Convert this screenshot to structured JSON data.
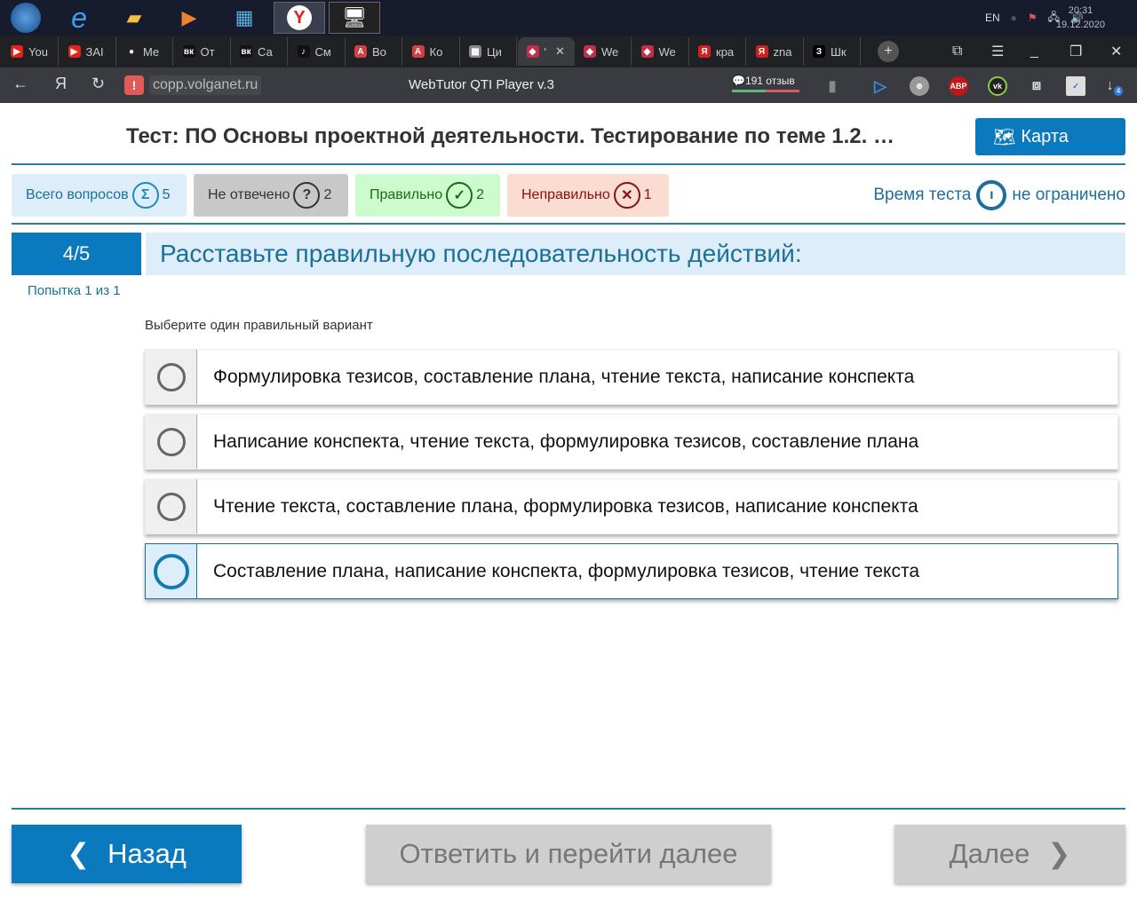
{
  "taskbar": {
    "lang": "EN",
    "time": "20:31",
    "date": "19.12.2020"
  },
  "tabs": [
    {
      "label": "You",
      "color": "#e62117",
      "glyph": "▶"
    },
    {
      "label": "ЗАІ",
      "color": "#e62117",
      "glyph": "▶"
    },
    {
      "label": "Me",
      "color": "#222",
      "glyph": "●"
    },
    {
      "label": "От",
      "color": "#111",
      "glyph": "вк"
    },
    {
      "label": "Са",
      "color": "#111",
      "glyph": "вк"
    },
    {
      "label": "См",
      "color": "#111",
      "glyph": "♪"
    },
    {
      "label": "Во",
      "color": "#d04040",
      "glyph": "A"
    },
    {
      "label": "Ко",
      "color": "#d04040",
      "glyph": "A"
    },
    {
      "label": "Ци",
      "color": "#888",
      "glyph": "▦"
    },
    {
      "label": "'",
      "color": "#c0304a",
      "glyph": "◆"
    },
    {
      "label": "We",
      "color": "#c0304a",
      "glyph": "◆"
    },
    {
      "label": "We",
      "color": "#c0304a",
      "glyph": "◆"
    },
    {
      "label": "кра",
      "color": "#d02020",
      "glyph": "Я"
    },
    {
      "label": "zna",
      "color": "#d02020",
      "glyph": "Я"
    },
    {
      "label": "Шк",
      "color": "#000",
      "glyph": "З"
    }
  ],
  "browser": {
    "url": "copp.volganet.ru",
    "title": "WebTutor QTI Player v.3",
    "reviews": "191 отзыв",
    "downloads": "4",
    "abp": "ABP"
  },
  "header": {
    "title": "Тест: ПО Основы проектной деятельности. Тестирование по теме 1.2. …",
    "map_button": "Карта"
  },
  "stats": {
    "total": {
      "label": "Всего вопросов",
      "value": "5",
      "icon": "Σ"
    },
    "unanswered": {
      "label": "Не отвечено",
      "value": "2",
      "icon": "?"
    },
    "correct": {
      "label": "Правильно",
      "value": "2",
      "icon": "✓"
    },
    "wrong": {
      "label": "Неправильно",
      "value": "1",
      "icon": "✕"
    },
    "time_label": "Время теста",
    "time_value": "не ограничено"
  },
  "question": {
    "number": "4/5",
    "text": "Расставьте правильную последовательность действий:",
    "attempt": "Попытка 1 из 1",
    "hint": "Выберите один правильный вариант",
    "options": [
      "Формулировка тезисов, составление плана, чтение текста, написание конспекта",
      "Написание конспекта, чтение текста, формулировка тезисов, составление плана",
      "Чтение текста, составление плана, формулировка тезисов, написание конспекта",
      "Составление плана, написание конспекта, формулировка тезисов, чтение текста"
    ]
  },
  "footer": {
    "back": "Назад",
    "submit": "Ответить и перейти далее",
    "next": "Далее"
  }
}
